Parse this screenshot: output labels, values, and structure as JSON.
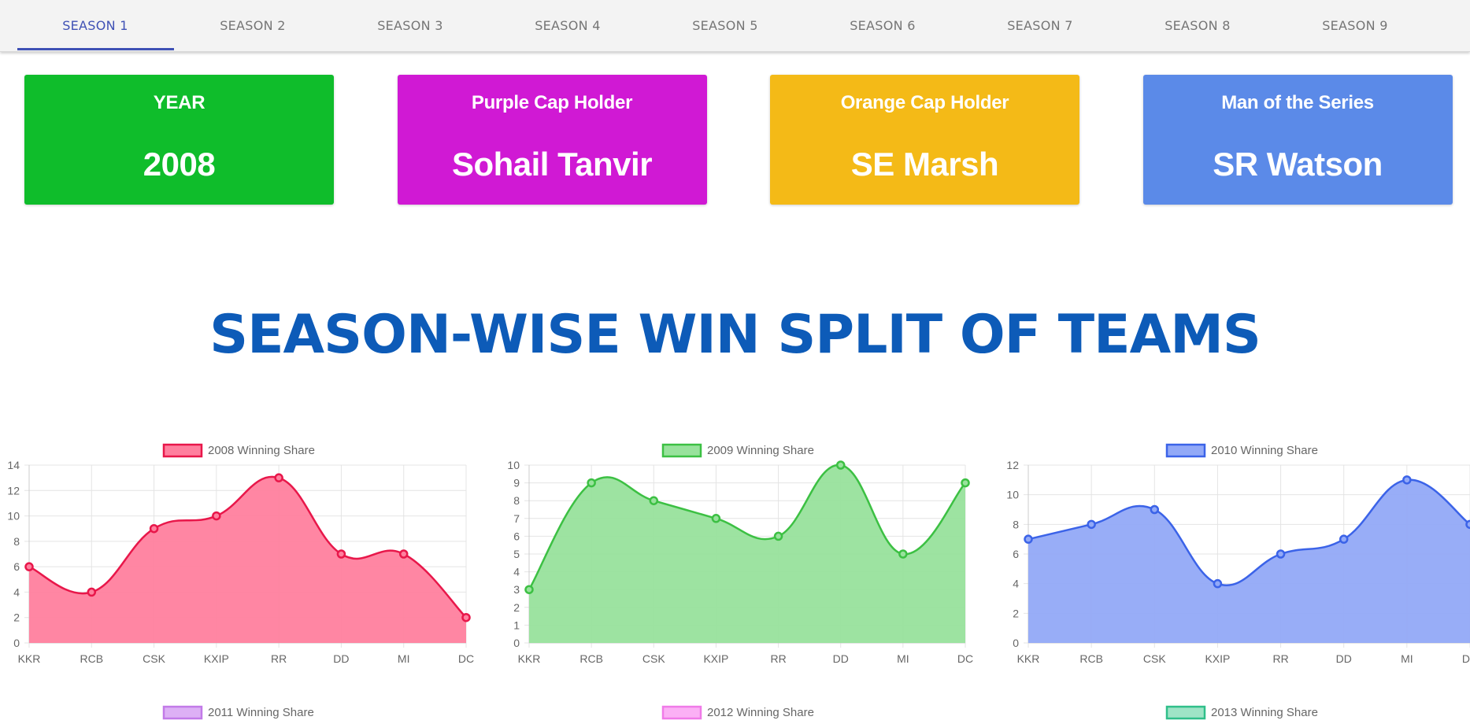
{
  "tabs": [
    {
      "label": "SEASON 1",
      "active": true
    },
    {
      "label": "SEASON 2",
      "active": false
    },
    {
      "label": "SEASON 3",
      "active": false
    },
    {
      "label": "SEASON 4",
      "active": false
    },
    {
      "label": "SEASON 5",
      "active": false
    },
    {
      "label": "SEASON 6",
      "active": false
    },
    {
      "label": "SEASON 7",
      "active": false
    },
    {
      "label": "SEASON 8",
      "active": false
    },
    {
      "label": "SEASON 9",
      "active": false
    }
  ],
  "cards": [
    {
      "label": "YEAR",
      "value": "2008",
      "color": "#0fbd2b"
    },
    {
      "label": "Purple Cap Holder",
      "value": "Sohail Tanvir",
      "color": "#d019d4"
    },
    {
      "label": "Orange Cap Holder",
      "value": "SE Marsh",
      "color": "#f4ba17"
    },
    {
      "label": "Man of the Series",
      "value": "SR Watson",
      "color": "#5b8ae8"
    }
  ],
  "section_title": "SEASON-WISE WIN SPLIT OF TEAMS",
  "chart_data": [
    {
      "type": "area",
      "legend": "2008 Winning Share",
      "categories": [
        "KKR",
        "RCB",
        "CSK",
        "KXIP",
        "RR",
        "DD",
        "MI",
        "DC"
      ],
      "values": [
        6,
        4,
        9,
        10,
        13,
        7,
        7,
        2
      ],
      "ylim": [
        0,
        14
      ],
      "yticks": [
        0,
        2,
        4,
        6,
        8,
        10,
        12,
        14
      ],
      "line_color": "#e8174a",
      "fill_color": "#ff7f9e",
      "grid": true,
      "legend_position": "top"
    },
    {
      "type": "area",
      "legend": "2009 Winning Share",
      "categories": [
        "KKR",
        "RCB",
        "CSK",
        "KXIP",
        "RR",
        "DD",
        "MI",
        "DC"
      ],
      "values": [
        3,
        9,
        8,
        7,
        6,
        10,
        5,
        9
      ],
      "ylim": [
        0,
        10
      ],
      "yticks": [
        0,
        1,
        2,
        3,
        4,
        5,
        6,
        7,
        8,
        9,
        10
      ],
      "line_color": "#3cc043",
      "fill_color": "#98e29c",
      "grid": true,
      "legend_position": "top"
    },
    {
      "type": "area",
      "legend": "2010 Winning Share",
      "categories": [
        "KKR",
        "RCB",
        "CSK",
        "KXIP",
        "RR",
        "DD",
        "MI",
        "DC"
      ],
      "values": [
        7,
        8,
        9,
        4,
        6,
        7,
        11,
        8
      ],
      "ylim": [
        0,
        12
      ],
      "yticks": [
        0,
        2,
        4,
        6,
        8,
        10,
        12
      ],
      "line_color": "#3b63e8",
      "fill_color": "#92a9f7",
      "grid": true,
      "legend_position": "top"
    }
  ],
  "lower_legends": [
    {
      "label": "2011 Winning Share",
      "line_color": "#c27ae8",
      "fill_color": "#ddb0f5"
    },
    {
      "label": "2012 Winning Share",
      "line_color": "#f07ae8",
      "fill_color": "#fbb0f5"
    },
    {
      "label": "2013 Winning Share",
      "line_color": "#2fbf8a",
      "fill_color": "#9ee4c6"
    }
  ]
}
